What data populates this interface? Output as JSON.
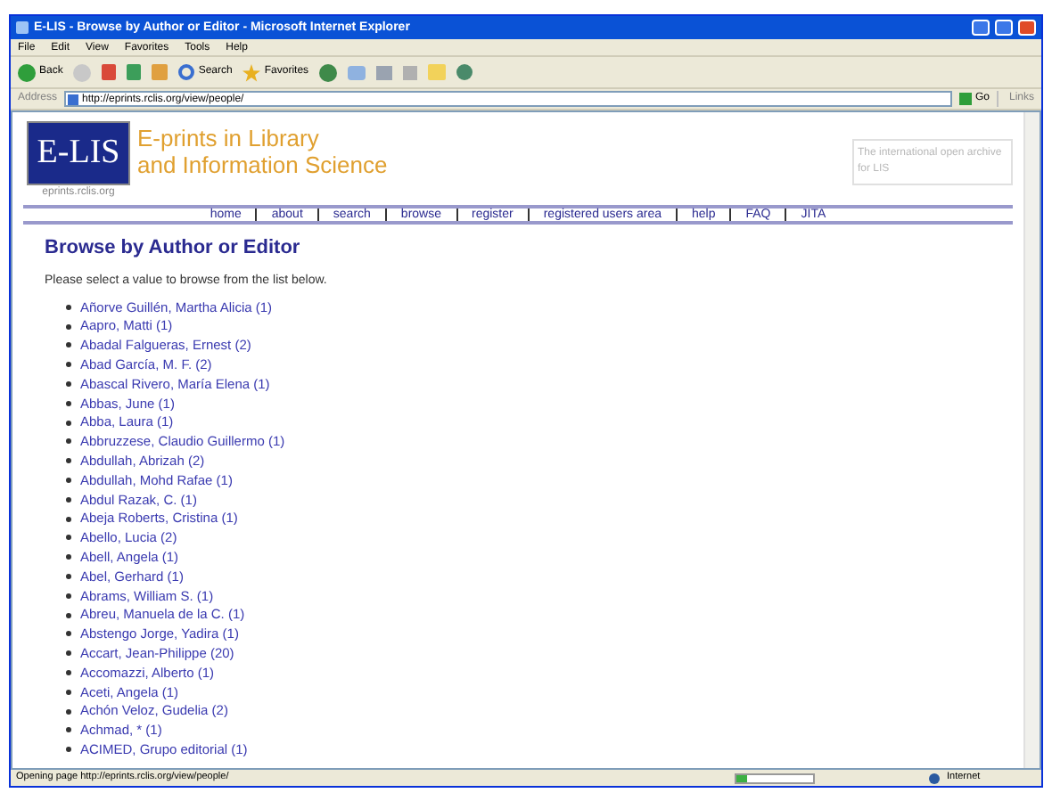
{
  "window": {
    "title": "E-LIS - Browse by Author or Editor - Microsoft Internet Explorer"
  },
  "menu": [
    "File",
    "Edit",
    "View",
    "Favorites",
    "Tools",
    "Help"
  ],
  "toolbar": {
    "back": "Back",
    "search": "Search",
    "favorites": "Favorites"
  },
  "address": {
    "label": "Address",
    "url": "http://eprints.rclis.org/view/people/",
    "go": "Go",
    "links": "Links"
  },
  "site": {
    "logo": "E-LIS",
    "logo_url": "eprints.rclis.org",
    "title_lines": [
      "E-prints in Library",
      "and Information Science"
    ],
    "tagline": "The international open archive for LIS"
  },
  "nav": [
    "home",
    "about",
    "search",
    "browse",
    "register",
    "registered users area",
    "help",
    "FAQ",
    "JITA"
  ],
  "heading": "Browse by Author or Editor",
  "intro": "Please select a value to browse from the list below.",
  "authors": [
    "Añorve Guillén, Martha Alicia (1)",
    "Aapro, Matti (1)",
    "Abadal Falgueras, Ernest (2)",
    "Abad García, M. F. (2)",
    "Abascal Rivero, María Elena (1)",
    "Abbas, June (1)",
    "Abba, Laura (1)",
    "Abbruzzese, Claudio Guillermo (1)",
    "Abdullah, Abrizah (2)",
    "Abdullah, Mohd Rafae (1)",
    "Abdul Razak, C. (1)",
    "Abeja Roberts, Cristina (1)",
    "Abello, Lucia (2)",
    "Abell, Angela (1)",
    "Abel, Gerhard (1)",
    "Abrams, William S. (1)",
    "Abreu, Manuela de la C. (1)",
    "Abstengo Jorge, Yadira (1)",
    "Accart, Jean-Philippe (20)",
    "Accomazzi, Alberto (1)",
    "Aceti, Angela (1)",
    "Achón Veloz, Gudelia (2)",
    "Achmad, * (1)",
    "ACIMED, Grupo editorial (1)"
  ],
  "status_bar": {
    "text": "Opening page http://eprints.rclis.org/view/people/",
    "zone": "Internet",
    "progress": {
      "level": 0.15
    }
  }
}
